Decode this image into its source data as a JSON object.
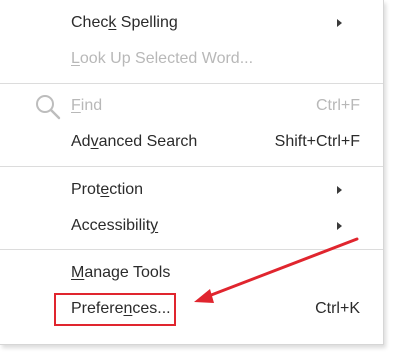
{
  "menu": {
    "items": [
      {
        "label": "Check Spelling",
        "mnemonic_before": "Chec",
        "mnemonic": "k",
        "mnemonic_after": " Spelling",
        "has_submenu": true
      },
      {
        "label": "Look Up Selected Word...",
        "mnemonic_before": "",
        "mnemonic": "L",
        "mnemonic_after": "ook Up Selected Word...",
        "disabled": true
      },
      {
        "label": "Find",
        "mnemonic_before": "",
        "mnemonic": "F",
        "mnemonic_after": "ind",
        "shortcut": "Ctrl+F",
        "disabled": true,
        "icon": "search-icon"
      },
      {
        "label": "Advanced Search",
        "mnemonic_before": "Ad",
        "mnemonic": "v",
        "mnemonic_after": "anced Search",
        "shortcut": "Shift+Ctrl+F"
      },
      {
        "label": "Protection",
        "mnemonic_before": "Prot",
        "mnemonic": "e",
        "mnemonic_after": "ction",
        "has_submenu": true
      },
      {
        "label": "Accessibility",
        "mnemonic_before": "Accessibilit",
        "mnemonic": "y",
        "mnemonic_after": "",
        "has_submenu": true
      },
      {
        "label": "Manage Tools",
        "mnemonic_before": "",
        "mnemonic": "M",
        "mnemonic_after": "anage Tools"
      },
      {
        "label": "Preferences...",
        "mnemonic_before": "Prefere",
        "mnemonic": "n",
        "mnemonic_after": "ces...",
        "shortcut": "Ctrl+K",
        "highlighted": true
      }
    ]
  },
  "colors": {
    "annotation": "#e0252e",
    "text": "#2b2b2b",
    "disabled_text": "#b8b8b8",
    "separator": "#dcdcdc"
  }
}
